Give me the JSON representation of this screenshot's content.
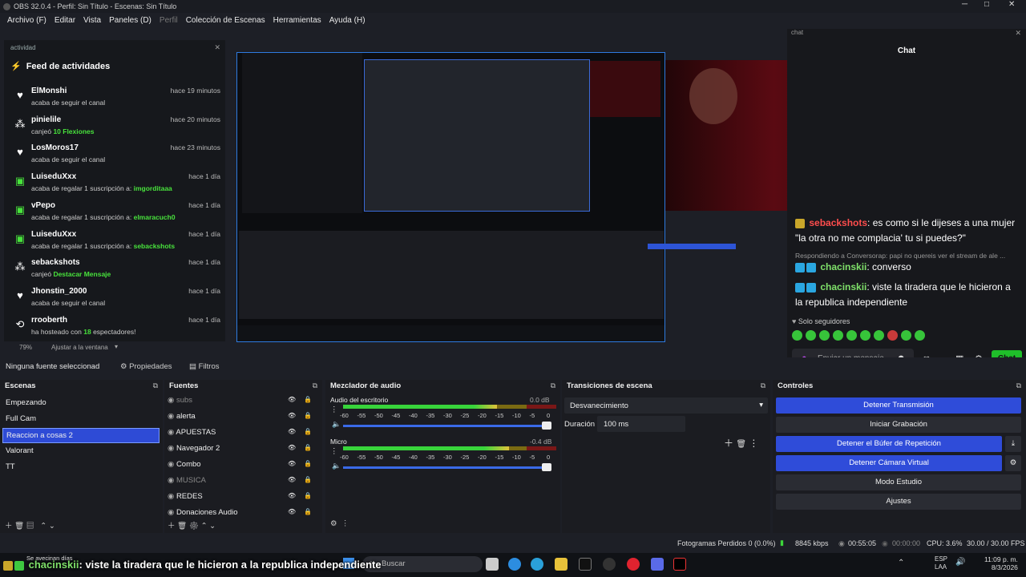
{
  "window": {
    "title": "OBS 32.0.4 - Perfil: Sin Título - Escenas: Sin Título"
  },
  "menu": {
    "items": [
      "Archivo (F)",
      "Editar",
      "Vista",
      "Paneles (D)",
      "Perfil",
      "Colección de Escenas",
      "Herramientas",
      "Ayuda (H)"
    ]
  },
  "activity": {
    "panel_title": "actividad",
    "feed_title": "Feed de actividades",
    "items": [
      {
        "name": "ElMonshi",
        "desc": "acaba de seguir el canal",
        "highlight": "",
        "time": "hace 19 minutos",
        "icon": "heart-icon"
      },
      {
        "name": "pinielile",
        "desc": "canjeó",
        "highlight": "10 Flexiones",
        "time": "hace 20 minutos",
        "icon": "points-icon"
      },
      {
        "name": "LosMoros17",
        "desc": "acaba de seguir el canal",
        "highlight": "",
        "time": "hace 23 minutos",
        "icon": "heart-icon"
      },
      {
        "name": "LuiseduXxx",
        "desc": "acaba de regalar 1 suscripción a:",
        "highlight": "imgorditaaa",
        "time": "hace 1 día",
        "icon": "gift-icon"
      },
      {
        "name": "vPepo",
        "desc": "acaba de regalar 1 suscripción a:",
        "highlight": "elmaracuch0",
        "time": "hace 1 día",
        "icon": "gift-icon"
      },
      {
        "name": "LuiseduXxx",
        "desc": "acaba de regalar 1 suscripción a:",
        "highlight": "sebackshots",
        "time": "hace 1 día",
        "icon": "gift-icon"
      },
      {
        "name": "sebackshots",
        "desc": "canjeó",
        "highlight": "Destacar Mensaje",
        "time": "hace 1 día",
        "icon": "points-icon"
      },
      {
        "name": "Jhonstin_2000",
        "desc": "acaba de seguir el canal",
        "highlight": "",
        "time": "hace 1 día",
        "icon": "heart-icon"
      },
      {
        "name": "rrooberth",
        "desc": "ha hosteado con",
        "highlight": "18",
        "desc2": "espectadores!",
        "time": "hace 1 día",
        "icon": "host-icon"
      }
    ]
  },
  "preview": {
    "zoom": "79%",
    "fit": "Ajustar a la ventana"
  },
  "chat": {
    "panel_title": "chat",
    "title": "Chat",
    "messages": [
      {
        "user": "sebackshots",
        "text": "es como si le dijeses a una mujer \"la otra no me complacia' tu si puedes?\""
      },
      {
        "reply": "Respondiendo a Conversorap: papi no quereis ver el stream de ale ..."
      },
      {
        "user": "chacinskii",
        "text": "converso"
      },
      {
        "user": "chacinskii",
        "text": "viste la tiradera que le hicieron a la republica independiente"
      }
    ],
    "mode": "Solo seguidores",
    "input_placeholder": "Enviar un mensaje",
    "send_label": "Chat"
  },
  "sourcebar": {
    "no_source": "Ninguna fuente seleccionad",
    "properties": "Propiedades",
    "filters": "Filtros"
  },
  "scenes": {
    "title": "Escenas",
    "items": [
      "Empezando",
      "Full Cam",
      "Reaccion a cosas 2",
      "Valorant",
      "TT"
    ],
    "selected": 2
  },
  "sources": {
    "title": "Fuentes",
    "items": [
      "subs",
      "alerta",
      "APUESTAS",
      "Navegador 2",
      "Combo",
      "MUSICA",
      "REDES",
      "Donaciones Audio"
    ]
  },
  "mixer": {
    "title": "Mezclador de audio",
    "channels": [
      {
        "name": "Audio del escritorio",
        "db": "0.0 dB",
        "level": 0.72
      },
      {
        "name": "Micro",
        "db": "-0.4 dB",
        "level": 0.78
      }
    ],
    "ticks": [
      "-60",
      "-55",
      "-50",
      "-45",
      "-40",
      "-35",
      "-30",
      "-25",
      "-20",
      "-15",
      "-10",
      "-5",
      "0"
    ]
  },
  "transitions": {
    "title": "Transiciones de escena",
    "selected": "Desvanecimiento",
    "duration_label": "Duración",
    "duration": "100 ms"
  },
  "controls": {
    "title": "Controles",
    "buttons": [
      "Detener Transmisión",
      "Iniciar Grabación",
      "Detener el Búfer de Repetición",
      "Detener Cámara Virtual",
      "Modo Estudio",
      "Ajustes"
    ]
  },
  "status": {
    "dropped": "Fotogramas Perdidos 0 (0.0%)",
    "bitrate": "8845 kbps",
    "stream_time": "00:55:05",
    "rec_time": "00:00:00",
    "cpu": "CPU: 3.6%",
    "fps": "30.00 / 30.00 FPS"
  },
  "overlay": {
    "user": "chacinskii",
    "text": ": viste la tiradera que le hicieron a la republica independiente",
    "small": "Se avecinan días"
  },
  "taskbar": {
    "search": "Buscar",
    "lang": "ESP",
    "lang2": "LAA",
    "time": "11:09 p. m.",
    "date": "8/3/2026"
  },
  "colors": {
    "accent": "#2f4cd9",
    "green": "#48e23c",
    "red": "#e0232f"
  }
}
